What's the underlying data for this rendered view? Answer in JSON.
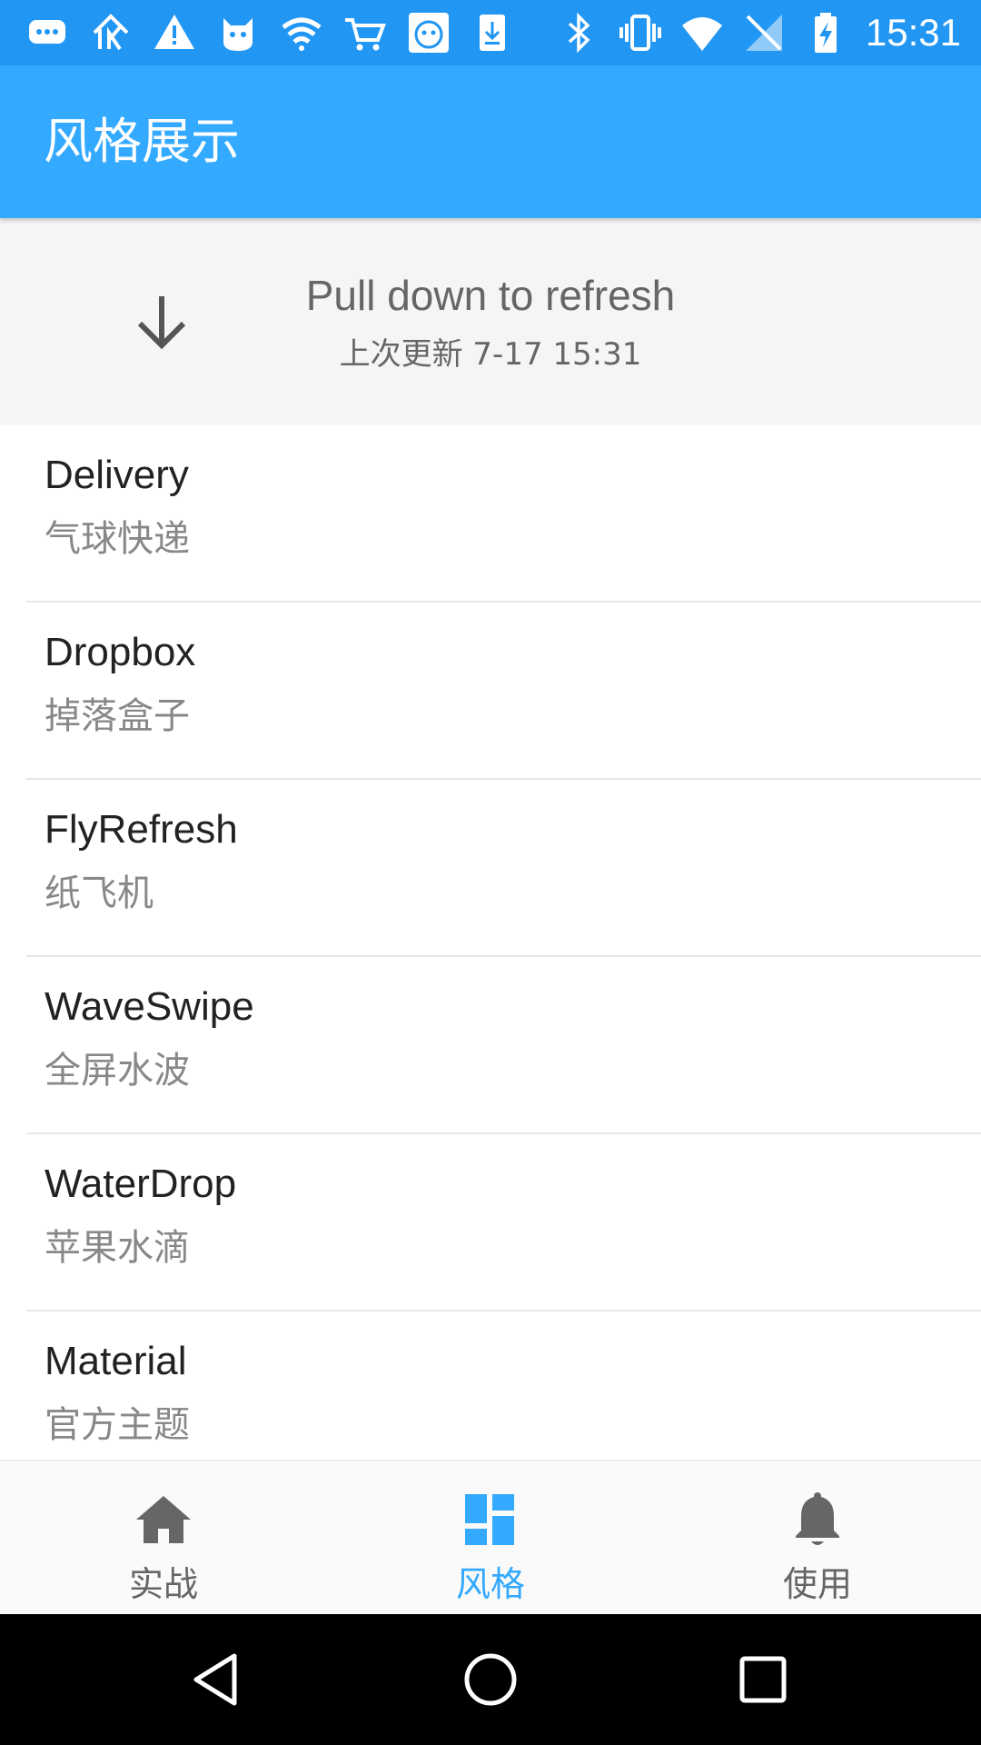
{
  "colors": {
    "status_bar": "#2196f3",
    "app_bar": "#33aaff",
    "accent": "#33aaff",
    "header_bg": "#f5f5f5"
  },
  "status_bar": {
    "time": "15:31",
    "left_icons": [
      "message-icon",
      "app-k-icon",
      "warning-icon",
      "cat-icon",
      "wifi-app-icon",
      "cart-icon",
      "cartoon-app-icon",
      "download-icon"
    ],
    "right_icons": [
      "bluetooth-icon",
      "vibrate-icon",
      "wifi-icon",
      "no-sim-icon",
      "battery-charging-icon"
    ]
  },
  "app_bar": {
    "title": "风格展示"
  },
  "refresh_header": {
    "title": "Pull down to refresh",
    "subtitle": "上次更新 7-17 15:31",
    "icon": "arrow-down-icon"
  },
  "list": {
    "items": [
      {
        "title": "Delivery",
        "subtitle": "气球快递"
      },
      {
        "title": "Dropbox",
        "subtitle": "掉落盒子"
      },
      {
        "title": "FlyRefresh",
        "subtitle": "纸飞机"
      },
      {
        "title": "WaveSwipe",
        "subtitle": "全屏水波"
      },
      {
        "title": "WaterDrop",
        "subtitle": "苹果水滴"
      },
      {
        "title": "Material",
        "subtitle": "官方主题"
      }
    ]
  },
  "bottom_nav": {
    "items": [
      {
        "label": "实战",
        "icon": "home-icon",
        "active": false
      },
      {
        "label": "风格",
        "icon": "dashboard-icon",
        "active": true
      },
      {
        "label": "使用",
        "icon": "bell-icon",
        "active": false
      }
    ]
  },
  "system_nav": {
    "buttons": [
      "back-icon",
      "home-circle-icon",
      "recents-icon"
    ]
  }
}
